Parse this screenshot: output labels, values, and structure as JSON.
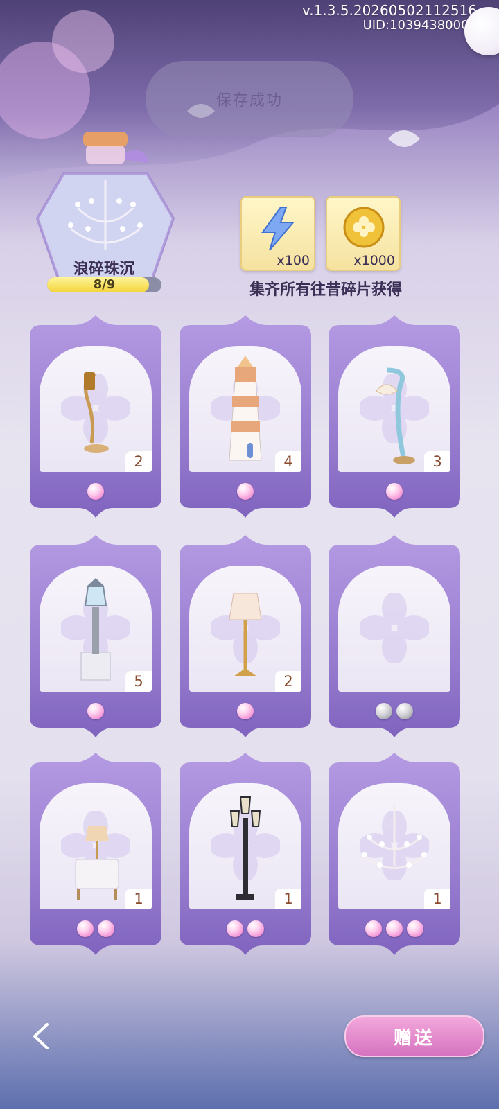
{
  "header": {
    "version": "v.1.3.5.20260502112516",
    "uid": "UID:10394380006"
  },
  "toast": {
    "text": "保存成功"
  },
  "collection": {
    "name": "浪碎珠沉",
    "progress_text": "8/9",
    "progress_value": 0.889
  },
  "rewards": [
    {
      "icon": "energy-bolt-icon",
      "qty": "x100"
    },
    {
      "icon": "clover-coin-icon",
      "qty": "x1000"
    }
  ],
  "reward_caption": "集齐所有往昔碎片获得",
  "cards": [
    {
      "item": "brass-wall-lamp",
      "count": "2",
      "pearls": 1,
      "pearl_color": "pink"
    },
    {
      "item": "lighthouse",
      "count": "4",
      "pearls": 1,
      "pearl_color": "pink"
    },
    {
      "item": "shell-street-lamp",
      "count": "3",
      "pearls": 1,
      "pearl_color": "pink"
    },
    {
      "item": "statue-lantern",
      "count": "5",
      "pearls": 1,
      "pearl_color": "pink"
    },
    {
      "item": "floor-lamp",
      "count": "2",
      "pearls": 1,
      "pearl_color": "pink"
    },
    {
      "item": "empty-slot",
      "count": "",
      "pearls": 2,
      "pearl_color": "grey"
    },
    {
      "item": "nightstand-lamp",
      "count": "1",
      "pearls": 2,
      "pearl_color": "pink"
    },
    {
      "item": "iron-street-lamp",
      "count": "1",
      "pearls": 2,
      "pearl_color": "pink"
    },
    {
      "item": "chandelier",
      "count": "1",
      "pearls": 3,
      "pearl_color": "pink"
    }
  ],
  "footer": {
    "back_icon": "chevron-left-icon",
    "gift_label": "赠送"
  },
  "colors": {
    "card_purple": "#9a7fd3",
    "pearl_pink": "#ec69c4",
    "gift_button": "#e58acf"
  }
}
